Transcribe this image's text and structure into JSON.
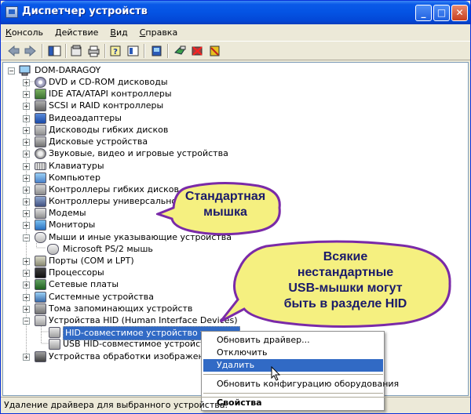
{
  "window": {
    "title": "Диспетчер устройств",
    "controls": {
      "minimize": "_",
      "maximize": "□",
      "close": "✕"
    }
  },
  "menu": [
    {
      "first": "К",
      "rest": "онсоль"
    },
    {
      "first": "Д",
      "rest": "ействие"
    },
    {
      "first": "В",
      "rest": "ид"
    },
    {
      "first": "С",
      "rest": "правка"
    }
  ],
  "toolbar": {
    "icons": [
      "back-icon",
      "forward-icon",
      "show-hide-tree-icon",
      "properties-icon",
      "print-icon",
      "help-icon",
      "console-tree-icon",
      "scan-hardware-icon",
      "update-driver-icon",
      "uninstall-icon",
      "disable-icon"
    ]
  },
  "tree": {
    "root": "DOM-DARAGOY",
    "items": [
      {
        "label": "DVD и CD-ROM дисководы",
        "icon": "cdrom-icon"
      },
      {
        "label": "IDE ATA/ATAPI контроллеры",
        "icon": "ide-controller-icon"
      },
      {
        "label": "SCSI и RAID контроллеры",
        "icon": "scsi-controller-icon"
      },
      {
        "label": "Видеоадаптеры",
        "icon": "display-adapter-icon"
      },
      {
        "label": "Дисководы гибких дисков",
        "icon": "floppy-drive-icon"
      },
      {
        "label": "Дисковые устройства",
        "icon": "disk-drive-icon"
      },
      {
        "label": "Звуковые, видео и игровые устройства",
        "icon": "sound-icon"
      },
      {
        "label": "Клавиатуры",
        "icon": "keyboard-icon"
      },
      {
        "label": "Компьютер",
        "icon": "computer-icon"
      },
      {
        "label": "Контроллеры гибких дисков",
        "icon": "floppy-controller-icon"
      },
      {
        "label": "Контроллеры универсальной",
        "icon": "usb-controller-icon"
      },
      {
        "label": "Модемы",
        "icon": "modem-icon"
      },
      {
        "label": "Мониторы",
        "icon": "monitor-icon"
      },
      {
        "label": "Мыши и иные указывающие устройства",
        "icon": "mouse-icon"
      },
      {
        "label": "Microsoft PS/2 мышь",
        "icon": "mouse-device-icon"
      },
      {
        "label": "Порты (COM и LPT)",
        "icon": "port-icon"
      },
      {
        "label": "Процессоры",
        "icon": "processor-icon"
      },
      {
        "label": "Сетевые платы",
        "icon": "network-card-icon"
      },
      {
        "label": "Системные устройства",
        "icon": "system-device-icon"
      },
      {
        "label": "Тома запоминающих устройств",
        "icon": "storage-volume-icon"
      },
      {
        "label": "Устройства HID (Human Interface Devices)",
        "icon": "hid-icon"
      },
      {
        "label": "HID-совместимое устройство управле",
        "icon": "hid-device-icon"
      },
      {
        "label": "USB HID-совместимое устройство",
        "icon": "usb-hid-device-icon"
      },
      {
        "label": "Устройства обработки изображений",
        "icon": "imaging-device-icon"
      }
    ]
  },
  "callouts": {
    "standard": [
      "Стандартная",
      "мышка"
    ],
    "nonstandard": [
      "Всякие",
      "нестандартные",
      "USB-мышки могут",
      "быть в разделе HID"
    ]
  },
  "context_menu": {
    "items": [
      "Обновить драйвер...",
      "Отключить",
      "Удалить",
      "Обновить конфигурацию оборудования",
      "Свойства"
    ]
  },
  "status": {
    "text": "Удаление драйвера для выбранного устройства."
  },
  "colors": {
    "title_blue": "#0453e3",
    "selection": "#316ac5",
    "callout_fill": "#f5f080",
    "callout_border": "#7a2aa8"
  }
}
